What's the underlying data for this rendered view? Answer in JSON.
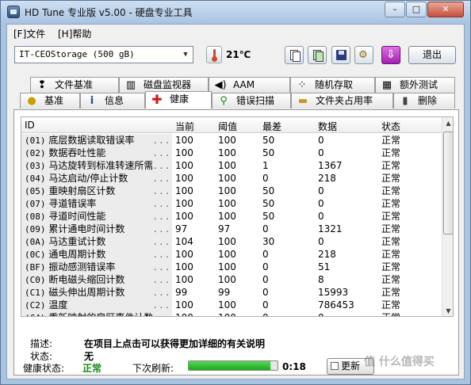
{
  "window": {
    "title": "HD Tune 专业版 v5.00 - 硬盘专业工具",
    "min": "–",
    "max": "□",
    "close": "✕"
  },
  "menu": {
    "file": "[F]文件",
    "help": "[H]帮助"
  },
  "toolbar": {
    "drive": "IT-CEOStorage (500 gB)",
    "temperature": "21℃",
    "exit_label": "退出",
    "icons": [
      "copy-text-icon",
      "copy-screen-icon",
      "save-icon",
      "options-icon",
      "download-icon"
    ]
  },
  "tabs_row1": [
    {
      "label": "文件基准",
      "icon": "info-icon"
    },
    {
      "label": "磁盘监视器",
      "icon": "monitor-chart-icon"
    },
    {
      "label": "AAM",
      "icon": "speaker-icon"
    },
    {
      "label": "随机存取",
      "icon": "random-dots-icon"
    },
    {
      "label": "额外测试",
      "icon": "tests-icon"
    }
  ],
  "tabs_row2": [
    {
      "label": "基准",
      "icon": "bulb-icon"
    },
    {
      "label": "信息",
      "icon": "info-icon"
    },
    {
      "label": "健康",
      "icon": "health-cross-icon",
      "active": true
    },
    {
      "label": "错误扫描",
      "icon": "magnifier-icon"
    },
    {
      "label": "文件夹占用率",
      "icon": "folder-icon"
    },
    {
      "label": "删除",
      "icon": "trash-icon"
    }
  ],
  "table": {
    "headers": {
      "id": "ID",
      "current": "当前",
      "threshold": "阈值",
      "worst": "最差",
      "data": "数据",
      "status": "状态"
    },
    "rows": [
      {
        "code": "(01)",
        "name": "底层数据读取错误率",
        "current": "100",
        "threshold": "100",
        "worst": "50",
        "data": "0",
        "status": "正常"
      },
      {
        "code": "(02)",
        "name": "数据吞吐性能",
        "current": "100",
        "threshold": "100",
        "worst": "50",
        "data": "0",
        "status": "正常"
      },
      {
        "code": "(03)",
        "name": "马达旋转到标准转速所需...",
        "current": "100",
        "threshold": "100",
        "worst": "1",
        "data": "1367",
        "status": "正常"
      },
      {
        "code": "(04)",
        "name": "马达启动/停止计数",
        "current": "100",
        "threshold": "100",
        "worst": "0",
        "data": "218",
        "status": "正常"
      },
      {
        "code": "(05)",
        "name": "重映射扇区计数",
        "current": "100",
        "threshold": "100",
        "worst": "50",
        "data": "0",
        "status": "正常"
      },
      {
        "code": "(07)",
        "name": "寻道错误率",
        "current": "100",
        "threshold": "100",
        "worst": "50",
        "data": "0",
        "status": "正常"
      },
      {
        "code": "(08)",
        "name": "寻道时间性能",
        "current": "100",
        "threshold": "100",
        "worst": "50",
        "data": "0",
        "status": "正常"
      },
      {
        "code": "(09)",
        "name": "累计通电时间计数",
        "current": "97",
        "threshold": "97",
        "worst": "0",
        "data": "1321",
        "status": "正常"
      },
      {
        "code": "(0A)",
        "name": "马达重试计数",
        "current": "104",
        "threshold": "100",
        "worst": "30",
        "data": "0",
        "status": "正常"
      },
      {
        "code": "(0C)",
        "name": "通电周期计数",
        "current": "100",
        "threshold": "100",
        "worst": "0",
        "data": "218",
        "status": "正常"
      },
      {
        "code": "(BF)",
        "name": "振动感测错误率",
        "current": "100",
        "threshold": "100",
        "worst": "0",
        "data": "51",
        "status": "正常"
      },
      {
        "code": "(C0)",
        "name": "断电磁头缩回计数",
        "current": "100",
        "threshold": "100",
        "worst": "0",
        "data": "8",
        "status": "正常"
      },
      {
        "code": "(C1)",
        "name": "磁头伸出周期计数",
        "current": "99",
        "threshold": "99",
        "worst": "0",
        "data": "15993",
        "status": "正常"
      },
      {
        "code": "(C2)",
        "name": "温度",
        "current": "100",
        "threshold": "100",
        "worst": "0",
        "data": "786453",
        "status": "正常"
      },
      {
        "code": "(C4)",
        "name": "重新映射的扇区事件计数",
        "current": "100",
        "threshold": "100",
        "worst": "0",
        "data": "0",
        "status": "正常"
      }
    ]
  },
  "details": {
    "desc_label": "描述:",
    "desc_text": "在项目上点击可以获得更加详细的有关说明",
    "state_label": "状态:",
    "state_text": "无"
  },
  "statusbar": {
    "health_label": "健康状态:",
    "health_value": "正常",
    "refresh_label": "下次刷新:",
    "refresh_time": "0:18",
    "refresh_progress": 0.92,
    "update_label": "更新"
  },
  "watermark": "值 什么值得买",
  "colors": {
    "health_ok": "#1a8a1a",
    "progress": "#1aa81a",
    "titlebar": "#a9c4e0"
  }
}
